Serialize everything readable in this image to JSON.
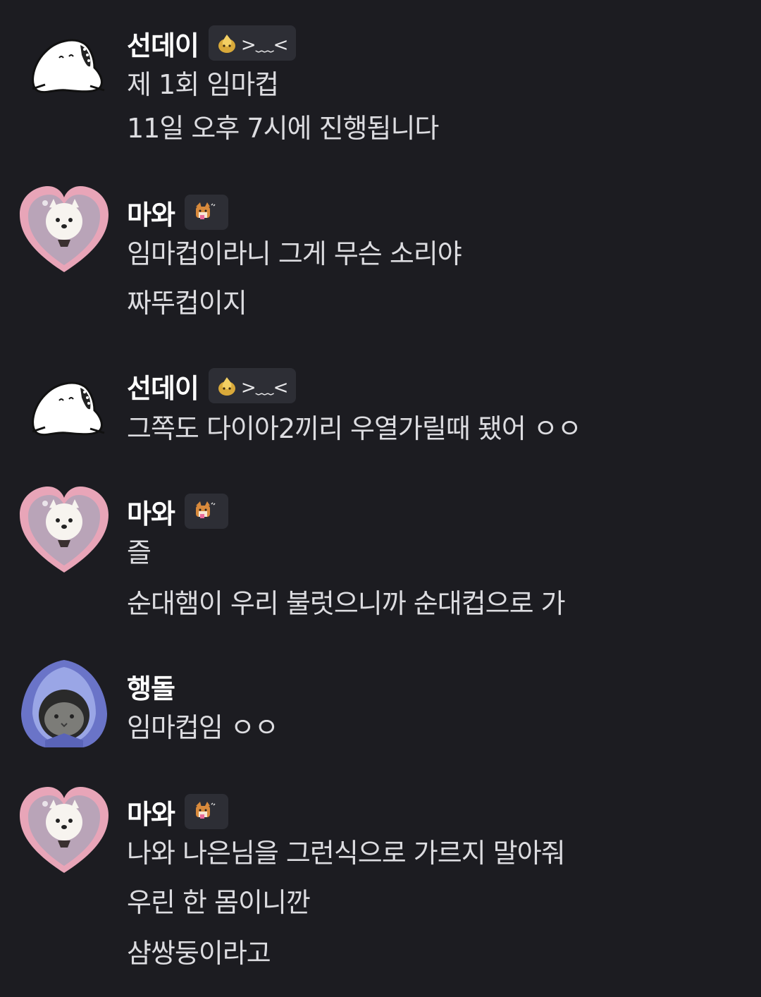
{
  "messages": [
    {
      "author": "선데이",
      "avatar": "white-ghost-seal-avatar",
      "badge": {
        "icon": "gold-flame-icon",
        "text": ">﹏<"
      },
      "lines": [
        "제 1회 임마컵",
        "11일 오후 7시에 진행됩니다"
      ]
    },
    {
      "author": "마와",
      "avatar": "pomeranian-heart-avatar",
      "badge": {
        "icon": "shiba-dog-icon",
        "text": ""
      },
      "lines": [
        "임마컵이라니 그게 무슨 소리야",
        "짜뚜컵이지"
      ]
    },
    {
      "author": "선데이",
      "avatar": "white-ghost-seal-avatar",
      "badge": {
        "icon": "gold-flame-icon",
        "text": ">﹏<"
      },
      "lines": [
        "그쪽도 다이아2끼리 우열가릴때 됐어 ㅇㅇ"
      ]
    },
    {
      "author": "마와",
      "avatar": "pomeranian-heart-avatar",
      "badge": {
        "icon": "shiba-dog-icon",
        "text": ""
      },
      "lines": [
        "즐",
        "순대햄이 우리 불럿으니까 순대컵으로 가"
      ]
    },
    {
      "author": "행돌",
      "avatar": "hooded-cat-avatar",
      "badge": null,
      "lines": [
        "임마컵임 ㅇㅇ"
      ]
    },
    {
      "author": "마와",
      "avatar": "pomeranian-heart-avatar",
      "badge": {
        "icon": "shiba-dog-icon",
        "text": ""
      },
      "lines": [
        "나와 나은님을 그런식으로 가르지 말아줘",
        "우린 한 몸이니깐",
        "샴쌍둥이라고"
      ]
    }
  ],
  "colors": {
    "background": "#1c1c21",
    "username": "#ffffff",
    "text": "#dcdce0",
    "badge_bg": "#2d2e35"
  }
}
